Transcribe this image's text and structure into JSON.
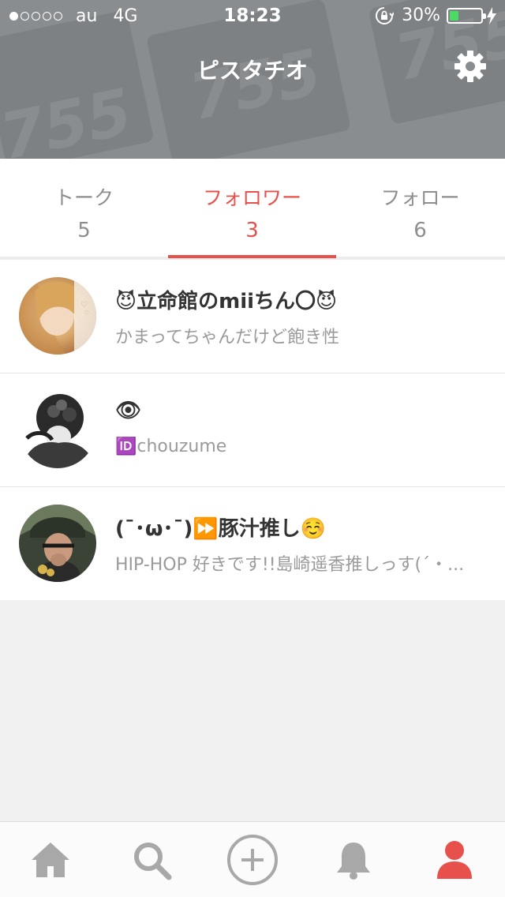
{
  "status_bar": {
    "carrier": "au",
    "network": "4G",
    "time": "18:23",
    "battery_percent": "30%",
    "battery_level": 0.3,
    "signal_filled": 1,
    "signal_total": 5
  },
  "header": {
    "title": "ピスタチオ",
    "background_deco": [
      "755",
      "755",
      "755"
    ]
  },
  "tabs": [
    {
      "label": "トーク",
      "count": "5",
      "active": false
    },
    {
      "label": "フォロワー",
      "count": "3",
      "active": true
    },
    {
      "label": "フォロー",
      "count": "6",
      "active": false
    }
  ],
  "followers": [
    {
      "name": "😈立命館のmiiちん〇😈",
      "bio": "かまってちゃんだけど飽き性"
    },
    {
      "name": "👁",
      "bio": "🆔chouzume"
    },
    {
      "name": "(¯･ω･¯)⏩豚汁推し☺️",
      "bio": "HIP-HOP 好きです!!島崎遥香推しっす(´・..."
    }
  ],
  "bottom_nav": [
    {
      "icon": "home-icon",
      "active": false
    },
    {
      "icon": "search-icon",
      "active": false
    },
    {
      "icon": "add-circle-icon",
      "active": false
    },
    {
      "icon": "bell-icon",
      "active": false
    },
    {
      "icon": "profile-icon",
      "active": true
    }
  ],
  "colors": {
    "accent": "#e8504c",
    "header_bg": "#8a8d90",
    "inactive_icon": "#a8a8a8",
    "battery": "#4cd964"
  }
}
